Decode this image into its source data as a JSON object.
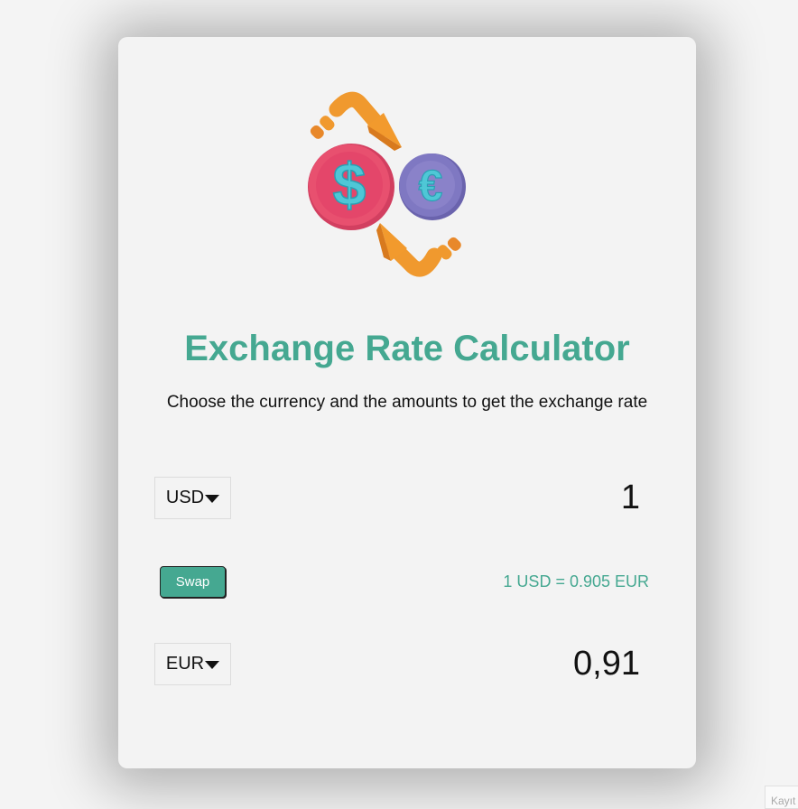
{
  "header": {
    "title": "Exchange Rate Calculator",
    "subtitle": "Choose the currency and the amounts to get the exchange rate",
    "logo_icon": "currency-exchange-icon"
  },
  "currency_one": {
    "selected": "USD",
    "amount": "1"
  },
  "swap": {
    "label": "Swap",
    "rate_text": "1 USD = 0.905 EUR"
  },
  "currency_two": {
    "selected": "EUR",
    "amount": "0,91"
  },
  "colors": {
    "accent": "#45a891",
    "card_bg": "#f3f3f3",
    "page_bg": "#f4f4f4",
    "dollar_coin": "#e8506f",
    "euro_coin": "#7f78c2",
    "arrow": "#f0992e",
    "symbol": "#4fc7d6"
  },
  "corner_tab": {
    "text": "Kayıt"
  }
}
